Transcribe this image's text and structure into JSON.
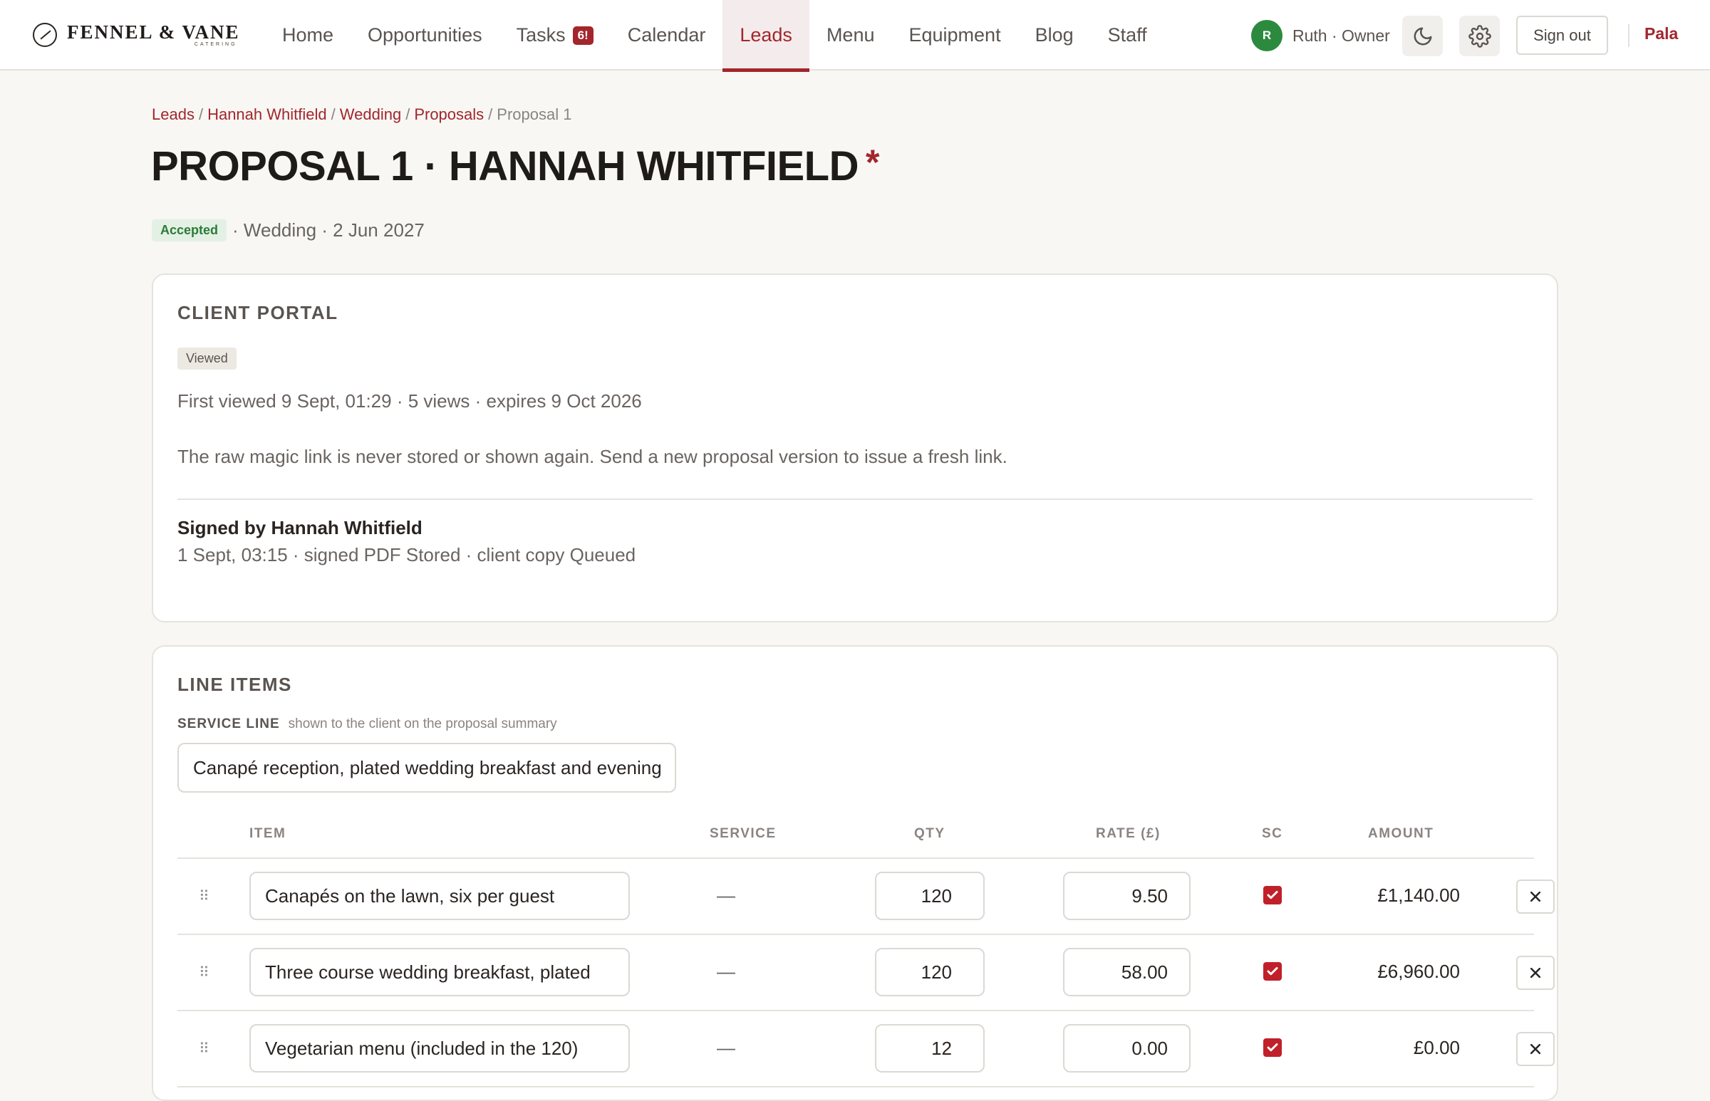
{
  "brand": {
    "name": "FENNEL & VANE",
    "sub": "CATERING"
  },
  "nav": {
    "items": [
      {
        "label": "Home"
      },
      {
        "label": "Opportunities"
      },
      {
        "label": "Tasks",
        "badge": "6!"
      },
      {
        "label": "Calendar"
      },
      {
        "label": "Leads",
        "active": true
      },
      {
        "label": "Menu"
      },
      {
        "label": "Equipment"
      },
      {
        "label": "Blog"
      },
      {
        "label": "Staff"
      }
    ],
    "user": {
      "initial": "R",
      "label": "Ruth · Owner"
    },
    "theme_icon": "moon-icon",
    "settings_icon": "gear-icon",
    "sign_out": "Sign out",
    "workspace": "Pala"
  },
  "breadcrumb": {
    "items": [
      "Leads",
      "Hannah Whitfield",
      "Wedding",
      "Proposals"
    ],
    "current": "Proposal 1"
  },
  "header": {
    "title": "PROPOSAL 1 · HANNAH WHITFIELD",
    "title_marker": "*",
    "status": "Accepted",
    "meta": "· Wedding · 2 Jun 2027"
  },
  "portal": {
    "heading": "CLIENT PORTAL",
    "status": "Viewed",
    "views_line": "First viewed 9 Sept, 01:29 · 5 views · expires 9 Oct 2026",
    "note": "The raw magic link is never stored or shown again. Send a new proposal version to issue a fresh link.",
    "signed_by": "Signed by Hannah Whitfield",
    "signed_detail": "1 Sept, 03:15 · signed PDF Stored · client copy Queued"
  },
  "line_items": {
    "heading": "LINE ITEMS",
    "service_label": "SERVICE LINE",
    "service_hint": "shown to the client on the proposal summary",
    "service_value": "Canapé reception, plated wedding breakfast and evening",
    "columns": {
      "item": "ITEM",
      "service": "SERVICE",
      "qty": "QTY",
      "rate": "RATE (£)",
      "sc": "SC",
      "amount": "AMOUNT"
    },
    "rows": [
      {
        "item": "Canapés on the lawn, six per guest",
        "service": "—",
        "qty": "120",
        "rate": "9.50",
        "sc": true,
        "amount": "£1,140.00"
      },
      {
        "item": "Three course wedding breakfast, plated",
        "service": "—",
        "qty": "120",
        "rate": "58.00",
        "sc": true,
        "amount": "£6,960.00"
      },
      {
        "item": "Vegetarian menu (included in the 120)",
        "service": "—",
        "qty": "12",
        "rate": "0.00",
        "sc": true,
        "amount": "£0.00"
      }
    ]
  },
  "colors": {
    "accent": "#a2262c",
    "checkbox": "#c0202a",
    "accepted_bg": "#e3f1e4",
    "accepted_fg": "#2c7a3a",
    "avatar": "#2c8a3e"
  }
}
